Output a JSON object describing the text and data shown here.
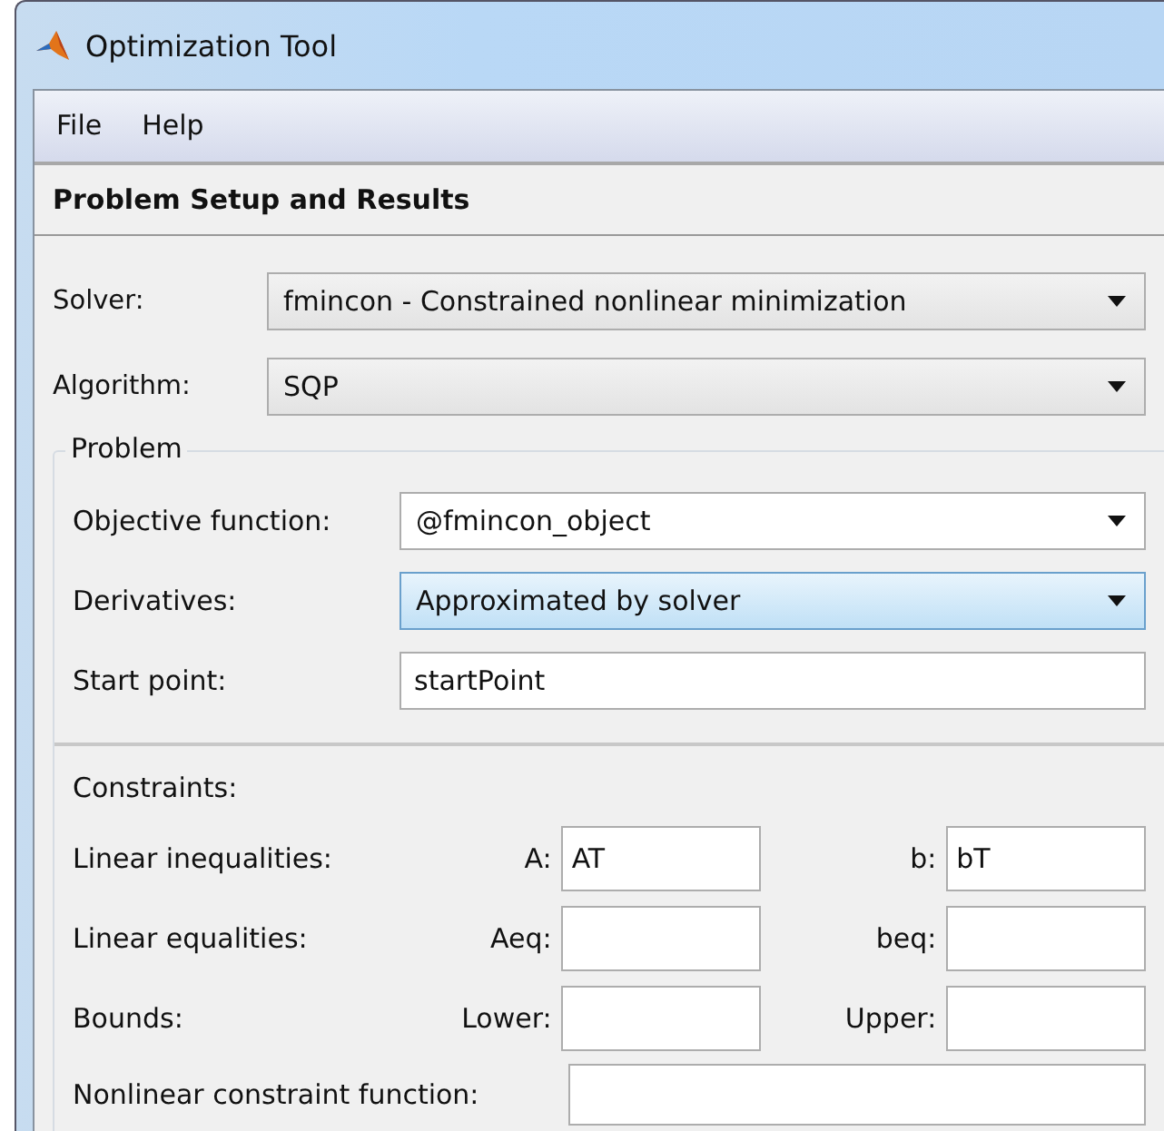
{
  "window": {
    "title": "Optimization Tool"
  },
  "menu": [
    "File",
    "Help"
  ],
  "panel_title": "Problem Setup and Results",
  "top_rows": [
    {
      "label": "Solver:",
      "value": "fmincon - Constrained nonlinear minimization",
      "highlighted": false
    },
    {
      "label": "Algorithm:",
      "value": "SQP",
      "highlighted": false
    }
  ],
  "problem": {
    "title": "Problem",
    "rows": [
      {
        "kind": "dropdown",
        "label": "Objective function:",
        "value": "@fmincon_object",
        "highlighted": false
      },
      {
        "kind": "dropdown",
        "label": "Derivatives:",
        "value": "Approximated by solver",
        "highlighted": true
      },
      {
        "kind": "text",
        "label": "Start point:",
        "value": "startPoint",
        "highlighted": false
      }
    ],
    "constraints_title": "Constraints:",
    "constraints": [
      {
        "label": "Linear inequalities:",
        "field1_label": "A:",
        "field1_value": "AT",
        "field2_label": "b:",
        "field2_value": "bT"
      },
      {
        "label": "Linear equalities:",
        "field1_label": "Aeq:",
        "field2_label": "beq:"
      },
      {
        "label": "Bounds:",
        "field1_label": "Lower:",
        "field2_label": "Upper:"
      }
    ],
    "nonlinear": {
      "label": "Nonlinear constraint function:"
    }
  }
}
